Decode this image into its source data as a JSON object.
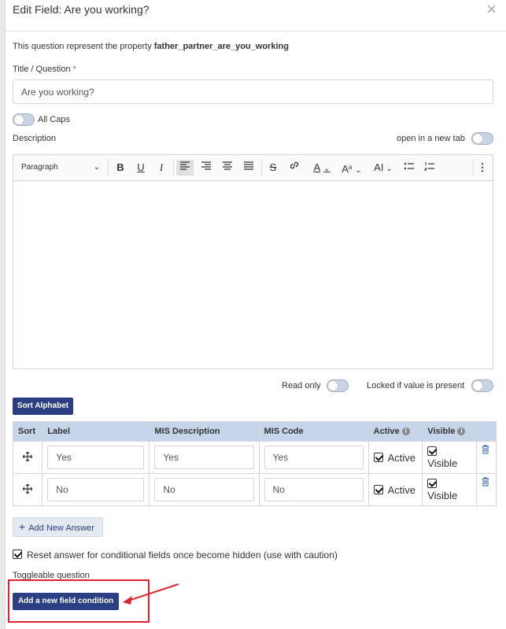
{
  "modal": {
    "title": "Edit Field: Are you working?",
    "close_symbol": "×",
    "property_prefix": "This question represent the property ",
    "property_name": "father_partner_are_you_working"
  },
  "title_question": {
    "label": "Title / Question",
    "required_mark": "*",
    "value": "Are you working?"
  },
  "all_caps_label": "All Caps",
  "description_label": "Description",
  "open_new_tab_label": "open in a new tab",
  "editor": {
    "paragraph_select": "Paragraph",
    "buttons": {
      "bold": "B",
      "underline": "U",
      "italic": "I",
      "strike": "S",
      "link": "🔗",
      "font_color": "A",
      "font_size": "A",
      "line_height": "AI",
      "more": "⋮"
    }
  },
  "read_only_label": "Read only",
  "locked_label": "Locked if value is present",
  "sort_alphabet_label": "Sort Alphabet",
  "table": {
    "headers": [
      "Sort",
      "Label",
      "MIS Description",
      "MIS Code",
      "Active",
      "Visible",
      ""
    ],
    "rows": [
      {
        "label": "Yes",
        "mis_description": "Yes",
        "mis_code": "Yes",
        "active": "Active",
        "visible": "Visible"
      },
      {
        "label": "No",
        "mis_description": "No",
        "mis_code": "No",
        "active": "Active",
        "visible": "Visible"
      }
    ]
  },
  "add_new_answer_label": "Add New Answer",
  "reset_answer_label": "Reset answer for conditional fields once become hidden (use with caution)",
  "toggleable_label": "Toggleable question",
  "add_condition_label": "Add a new field condition",
  "colors": {
    "primary": "#2a3f84",
    "table_header": "#c7d5ea",
    "highlight": "#e0242d"
  }
}
